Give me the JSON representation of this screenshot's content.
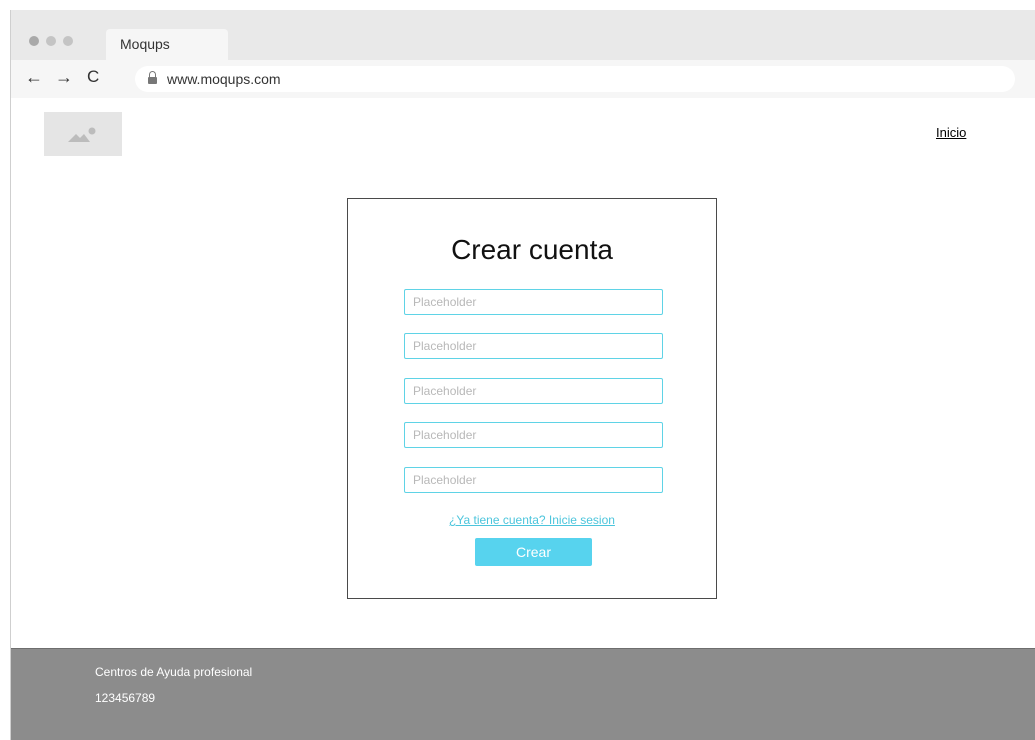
{
  "browser": {
    "tab_title": "Moqups",
    "url": "www.moqups.com",
    "back_icon": "←",
    "forward_icon": "→",
    "reload_icon": "C"
  },
  "header": {
    "nav_link": "Inicio"
  },
  "form": {
    "title": "Crear cuenta",
    "fields": [
      {
        "placeholder": "Placeholder",
        "value": ""
      },
      {
        "placeholder": "Placeholder",
        "value": ""
      },
      {
        "placeholder": "Placeholder",
        "value": ""
      },
      {
        "placeholder": "Placeholder",
        "value": ""
      },
      {
        "placeholder": "Placeholder",
        "value": ""
      }
    ],
    "login_link": "¿Ya tiene cuenta? Inicie sesion",
    "submit_label": "Crear"
  },
  "footer": {
    "line1": "Centros de Ayuda profesional",
    "line2": "123456789"
  },
  "colors": {
    "accent": "#57d3ee",
    "field_border": "#5fd3e6",
    "footer_bg": "#8c8c8c"
  }
}
